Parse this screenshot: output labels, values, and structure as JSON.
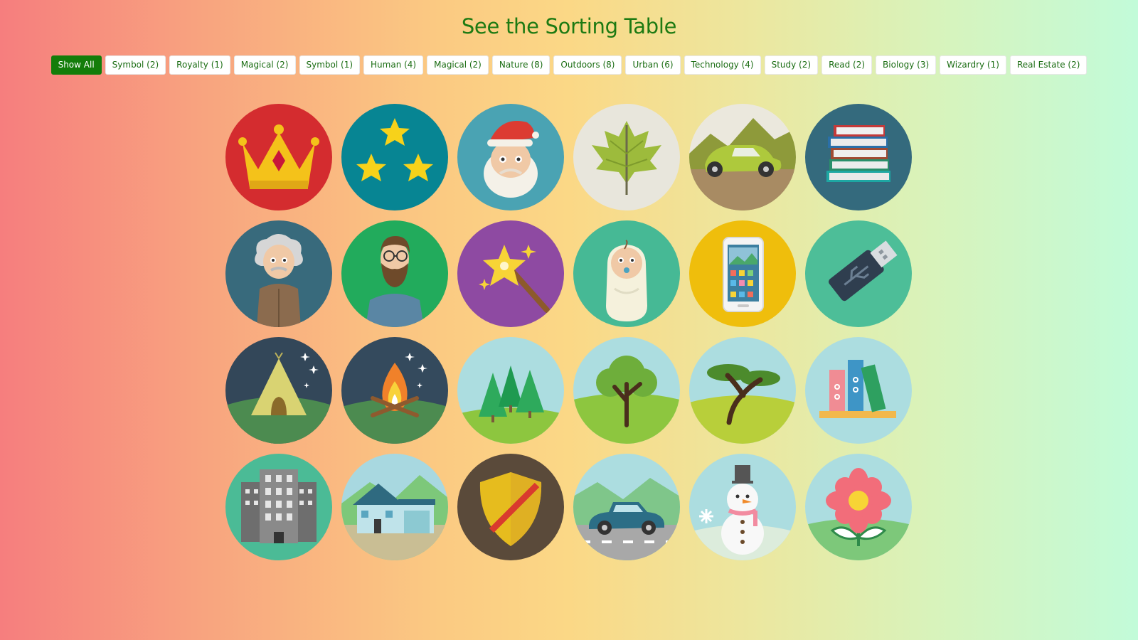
{
  "page": {
    "title": "See the Sorting Table"
  },
  "filters": [
    {
      "label": "Show All",
      "active": true
    },
    {
      "label": "Symbol (2)"
    },
    {
      "label": "Royalty (1)"
    },
    {
      "label": "Magical (2)"
    },
    {
      "label": "Symbol (1)"
    },
    {
      "label": "Human (4)"
    },
    {
      "label": "Magical (2)"
    },
    {
      "label": "Nature (8)"
    },
    {
      "label": "Outdoors (8)"
    },
    {
      "label": "Urban (6)"
    },
    {
      "label": "Technology (4)"
    },
    {
      "label": "Study (2)"
    },
    {
      "label": "Read (2)"
    },
    {
      "label": "Biology (3)"
    },
    {
      "label": "Wizardry (1)"
    },
    {
      "label": "Real Estate (2)"
    }
  ],
  "tiles": [
    {
      "icon": "crown-icon",
      "bg": "#d42c2f"
    },
    {
      "icon": "stars-icon",
      "bg": "#078593"
    },
    {
      "icon": "santa-icon",
      "bg": "#4aa3b3"
    },
    {
      "icon": "leaf-icon",
      "bg": "#e8e6dc"
    },
    {
      "icon": "car-landscape-icon",
      "bg": "#a88b63"
    },
    {
      "icon": "books-icon",
      "bg": "#346a7d"
    },
    {
      "icon": "einstein-icon",
      "bg": "#386a7c"
    },
    {
      "icon": "bearded-man-icon",
      "bg": "#22ab5c"
    },
    {
      "icon": "magic-wand-icon",
      "bg": "#8e4aa2"
    },
    {
      "icon": "baby-icon",
      "bg": "#46b995"
    },
    {
      "icon": "smartphone-icon",
      "bg": "#efbe0c"
    },
    {
      "icon": "usb-drive-icon",
      "bg": "#4dbe98"
    },
    {
      "icon": "tent-icon",
      "bg": "#334759"
    },
    {
      "icon": "campfire-icon",
      "bg": "#344a5d"
    },
    {
      "icon": "pine-trees-icon",
      "bg": "#acdde0"
    },
    {
      "icon": "tree-icon",
      "bg": "#acdde0"
    },
    {
      "icon": "acacia-tree-icon",
      "bg": "#acdde0"
    },
    {
      "icon": "binders-icon",
      "bg": "#acdde0"
    },
    {
      "icon": "office-building-icon",
      "bg": "#4bbb96"
    },
    {
      "icon": "house-icon",
      "bg": "#a8d8e0"
    },
    {
      "icon": "shield-icon",
      "bg": "#5a4a3a"
    },
    {
      "icon": "car-road-icon",
      "bg": "#acdde0"
    },
    {
      "icon": "snowman-icon",
      "bg": "#acdde0"
    },
    {
      "icon": "flower-icon",
      "bg": "#acdde0"
    }
  ]
}
